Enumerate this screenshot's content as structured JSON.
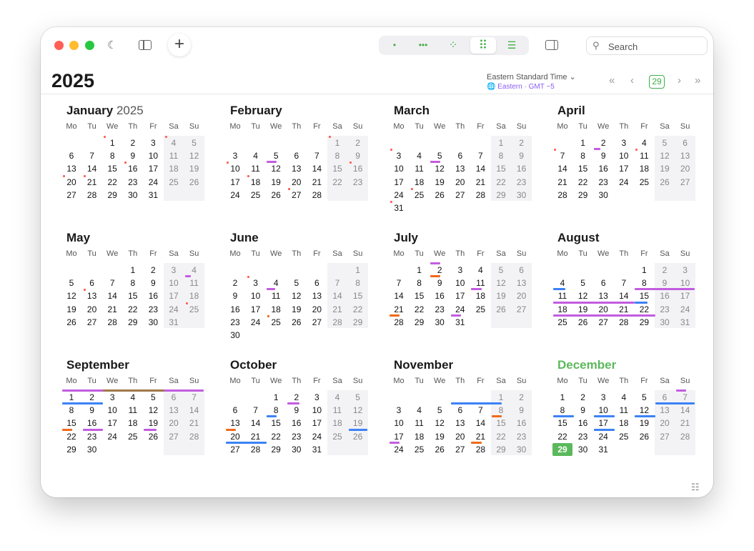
{
  "window": {
    "traffic_lights": [
      {
        "name": "close",
        "color": "#ff5f57"
      },
      {
        "name": "minimize",
        "color": "#febc2e"
      },
      {
        "name": "zoom",
        "color": "#28c840"
      }
    ]
  },
  "toolbar": {
    "add_label": "+",
    "view_modes": [
      {
        "name": "day-view",
        "glyph": "•",
        "active": false
      },
      {
        "name": "week-view",
        "glyph": "•••",
        "active": false
      },
      {
        "name": "month-view",
        "glyph": "⁘",
        "active": false
      },
      {
        "name": "year-view",
        "glyph": "⠿",
        "active": true
      },
      {
        "name": "list-view",
        "glyph": "☰",
        "active": false
      }
    ],
    "search_placeholder": "Search"
  },
  "header": {
    "year": "2025",
    "timezone_name": "Eastern Standard Time ⌄",
    "timezone_sub": "🌐 Eastern · GMT −5",
    "nav_first": "«",
    "nav_prev": "‹",
    "today_label": "29",
    "nav_next": "›",
    "nav_last": "»"
  },
  "weekday_labels": [
    "Mo",
    "Tu",
    "We",
    "Th",
    "Fr",
    "Sa",
    "Su"
  ],
  "accent_colors": {
    "green": "#3fae47",
    "today": "#5bb95b",
    "purple": "#c25ce0",
    "blue": "#3b82f6",
    "orange": "#f06a1a",
    "red": "#ff5f57",
    "brown": "#a0784a"
  },
  "months": [
    {
      "name": "January",
      "year_suffix": "2025",
      "current": false
    },
    {
      "name": "February",
      "year_suffix": "",
      "current": false
    },
    {
      "name": "March",
      "year_suffix": "",
      "current": false
    },
    {
      "name": "April",
      "year_suffix": "",
      "current": false
    },
    {
      "name": "May",
      "year_suffix": "",
      "current": false
    },
    {
      "name": "June",
      "year_suffix": "",
      "current": false
    },
    {
      "name": "July",
      "year_suffix": "",
      "current": false
    },
    {
      "name": "August",
      "year_suffix": "",
      "current": false
    },
    {
      "name": "September",
      "year_suffix": "",
      "current": false
    },
    {
      "name": "October",
      "year_suffix": "",
      "current": false
    },
    {
      "name": "November",
      "year_suffix": "",
      "current": false
    },
    {
      "name": "December",
      "year_suffix": "",
      "current": true
    }
  ],
  "today": {
    "month": 12,
    "day": 29
  }
}
